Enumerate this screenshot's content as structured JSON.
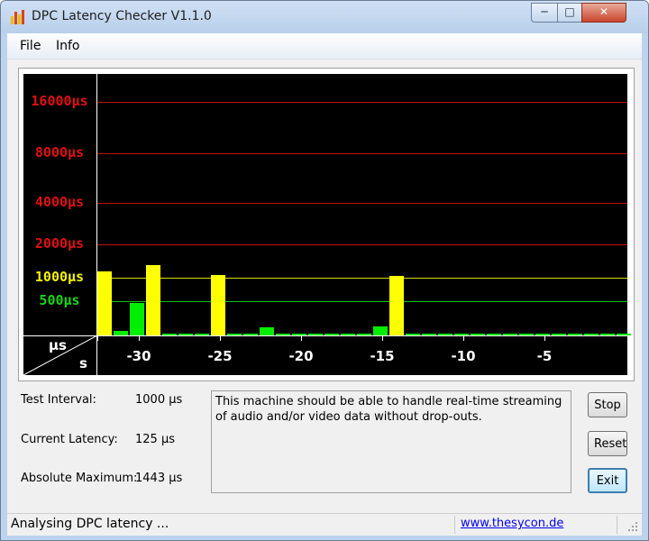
{
  "window": {
    "title": "DPC Latency Checker V1.1.0"
  },
  "controls": {
    "minimize": "─",
    "maximize": "□",
    "close": "✕"
  },
  "menu": [
    "File",
    "Info"
  ],
  "graph": {
    "y_labels": [
      {
        "text": "16000µs",
        "color": "red"
      },
      {
        "text": "8000µs",
        "color": "red"
      },
      {
        "text": "4000µs",
        "color": "red"
      },
      {
        "text": "2000µs",
        "color": "red"
      },
      {
        "text": "1000µs",
        "color": "yellow"
      },
      {
        "text": "500µs",
        "color": "green"
      }
    ],
    "x_labels": [
      "-30",
      "-25",
      "-20",
      "-15",
      "-10",
      "-5"
    ],
    "corner_y_unit": "µs",
    "corner_x_unit": "s"
  },
  "chart_data": {
    "type": "bar",
    "x_unit": "s",
    "y_unit": "µs",
    "y_scale": "log",
    "y_ticks": [
      500,
      1000,
      2000,
      4000,
      8000,
      16000
    ],
    "x_ticks": [
      -30,
      -25,
      -20,
      -15,
      -10,
      -5
    ],
    "values": [
      1210,
      210,
      470,
      1443,
      95,
      100,
      90,
      1080,
      180,
      160,
      230,
      180,
      150,
      120,
      150,
      140,
      120,
      240,
      1050,
      170,
      90,
      90,
      85,
      95,
      95,
      90,
      110,
      120,
      100,
      95,
      100,
      120,
      100
    ],
    "colors": [
      "#ffff00",
      "#00ee00",
      "#00ee00",
      "#ffff00",
      "#00ee00",
      "#00ee00",
      "#00ee00",
      "#ffff00",
      "#00ee00",
      "#00ee00",
      "#00ee00",
      "#00ee00",
      "#00ee00",
      "#00ee00",
      "#00ee00",
      "#00ee00",
      "#00ee00",
      "#00ee00",
      "#ffff00",
      "#00ee00",
      "#00ee00",
      "#00ee00",
      "#00ee00",
      "#00ee00",
      "#00ee00",
      "#00ee00",
      "#00ee00",
      "#00ee00",
      "#00ee00",
      "#00ee00",
      "#00ee00",
      "#00ee00",
      "#00ee00"
    ]
  },
  "info": {
    "test_interval_label": "Test Interval:",
    "test_interval_value": "1000 µs",
    "current_latency_label": "Current Latency:",
    "current_latency_value": "125 µs",
    "absolute_max_label": "Absolute Maximum:",
    "absolute_max_value": "1443 µs"
  },
  "message": "This machine should be able to handle real-time streaming of audio and/or video data without drop-outs.",
  "buttons": {
    "stop": "Stop",
    "reset": "Reset",
    "exit": "Exit"
  },
  "status": {
    "text": "Analysing DPC latency ...",
    "link": "www.thesycon.de"
  }
}
